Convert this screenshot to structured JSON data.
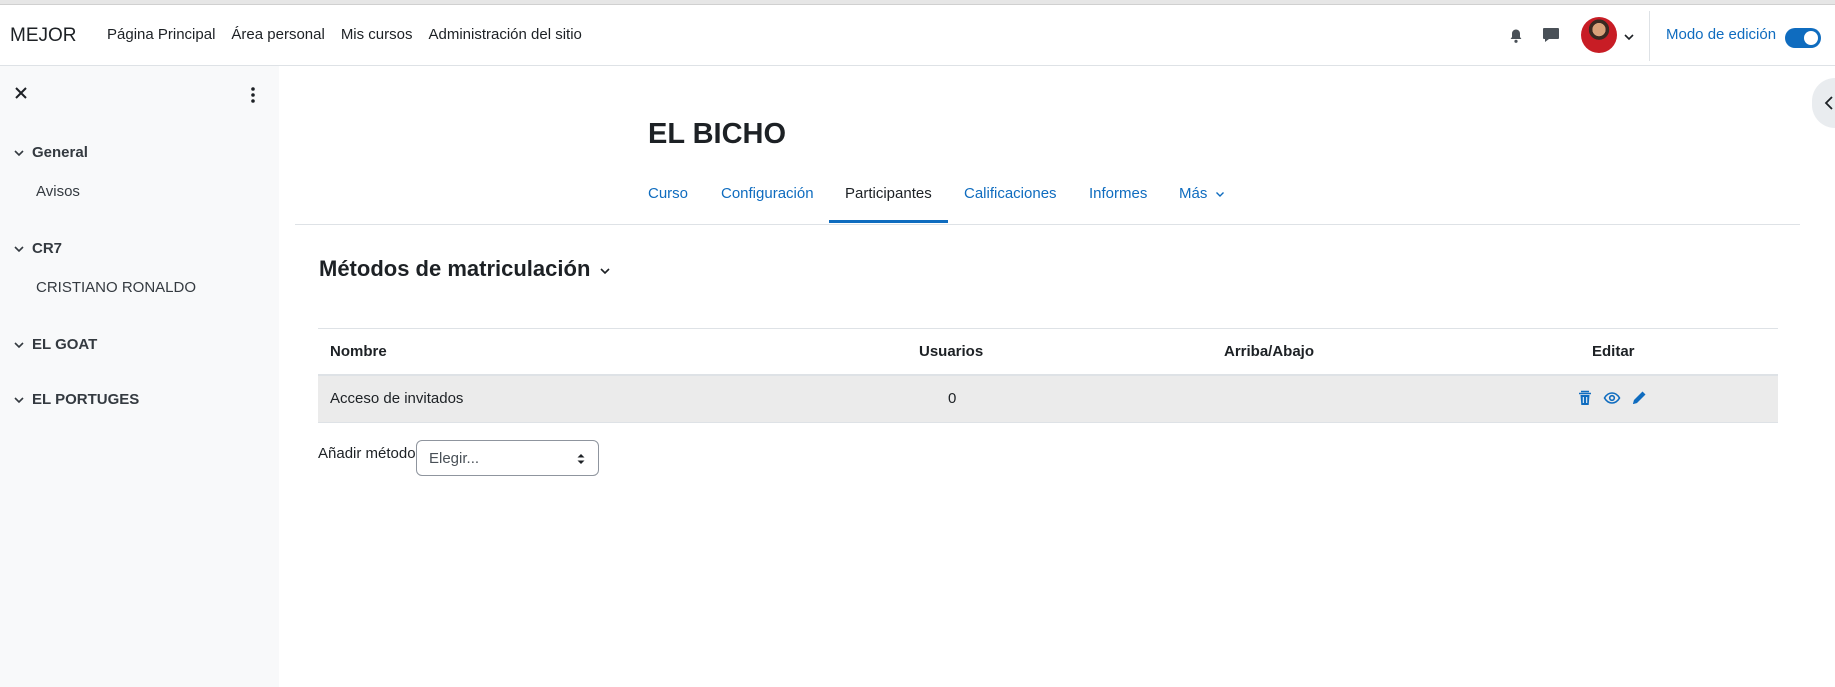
{
  "brand": "MEJOR",
  "primary_nav": [
    "Página Principal",
    "Área personal",
    "Mis cursos",
    "Administración del sitio"
  ],
  "edit_mode": {
    "label": "Modo de edición",
    "enabled": true
  },
  "drawer": {
    "sections": [
      {
        "label": "General",
        "items": [
          "Avisos"
        ]
      },
      {
        "label": "CR7",
        "items": [
          "CRISTIANO RONALDO"
        ]
      },
      {
        "label": "EL GOAT",
        "items": []
      },
      {
        "label": "EL PORTUGES",
        "items": []
      }
    ]
  },
  "course": {
    "title": "EL BICHO"
  },
  "tabs": [
    {
      "label": "Curso",
      "active": false
    },
    {
      "label": "Configuración",
      "active": false
    },
    {
      "label": "Participantes",
      "active": true
    },
    {
      "label": "Calificaciones",
      "active": false
    },
    {
      "label": "Informes",
      "active": false
    },
    {
      "label": "Más",
      "active": false
    }
  ],
  "page_heading": "Métodos de matriculación",
  "table": {
    "headers": [
      "Nombre",
      "Usuarios",
      "Arriba/Abajo",
      "Editar"
    ],
    "rows": [
      {
        "name": "Acceso de invitados",
        "users": "0",
        "updown": ""
      }
    ]
  },
  "add_method": {
    "label": "Añadir método",
    "selected": "Elegir..."
  },
  "colors": {
    "accent": "#0f6cbf",
    "drawer_bg": "#f8f9fa",
    "row_bg": "#ebebeb"
  }
}
